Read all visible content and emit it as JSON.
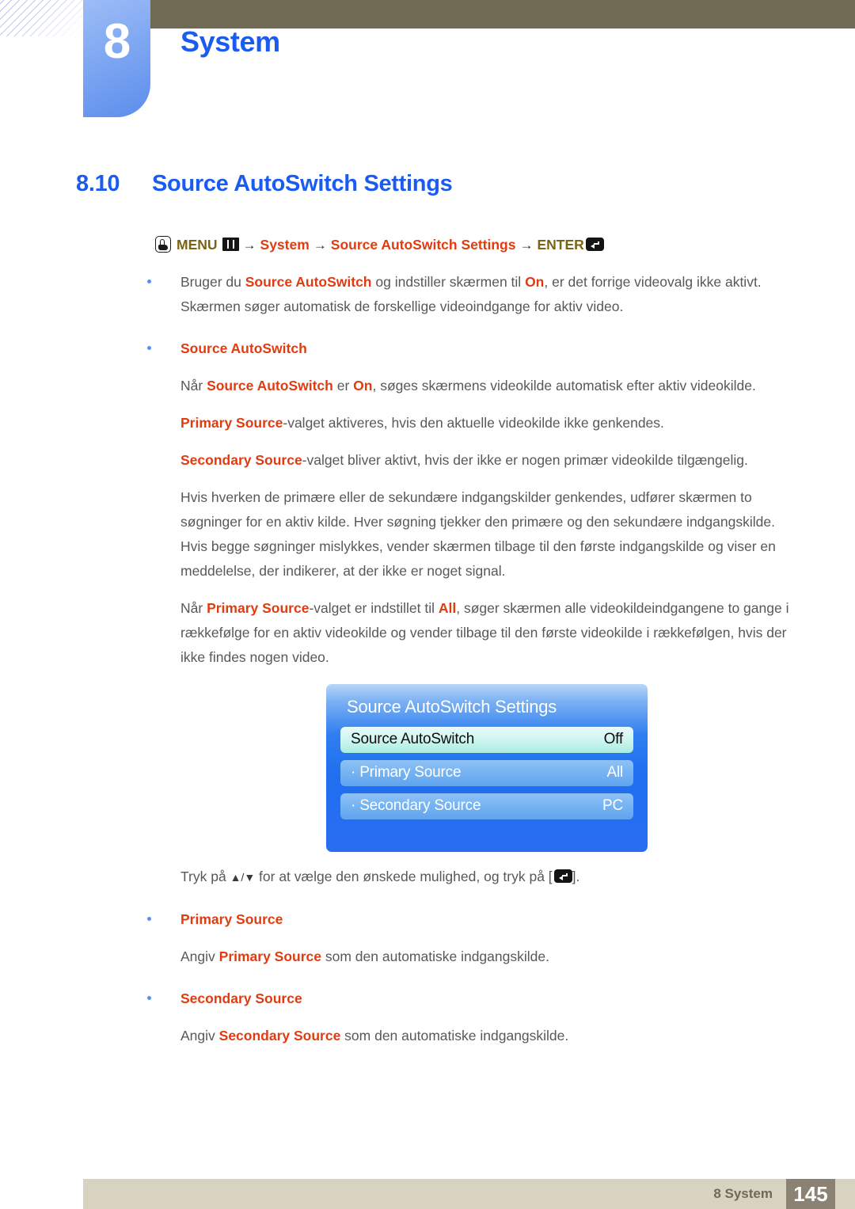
{
  "chapter": {
    "number": "8",
    "title": "System"
  },
  "section": {
    "number": "8.10",
    "title": "Source AutoSwitch Settings"
  },
  "menu_path": {
    "hand_icon": "hand-button-icon",
    "menu_label": "MENU",
    "grid_icon": "menu-grid-icon",
    "arrow1": "→",
    "item1": "System",
    "arrow2": "→",
    "item2": "Source AutoSwitch Settings",
    "arrow3": "→",
    "enter_label": "ENTER",
    "enter_icon": "enter-key-icon"
  },
  "body": {
    "bullet1_line1_pre": "Bruger du ",
    "bullet1_term1": "Source AutoSwitch",
    "bullet1_line1_mid": " og indstiller skærmen til ",
    "bullet1_term2": "On",
    "bullet1_line1_post": ", er det forrige videovalg ikke aktivt. Skærmen søger automatisk de forskellige videoindgange for aktiv video.",
    "bullet2_head": "Source AutoSwitch",
    "p1_pre": "Når ",
    "p1_term1": "Source AutoSwitch",
    "p1_mid": " er ",
    "p1_term2": "On",
    "p1_post": ", søges skærmens videokilde automatisk efter aktiv videokilde.",
    "p2_term": "Primary Source",
    "p2_post": "-valget aktiveres, hvis den aktuelle videokilde ikke genkendes.",
    "p3_term": "Secondary Source",
    "p3_post": "-valget bliver aktivt, hvis der ikke er nogen primær videokilde tilgængelig.",
    "p4": "Hvis hverken de primære eller de sekundære indgangskilder genkendes, udfører skærmen to søgninger for en aktiv kilde. Hver søgning tjekker den primære og den sekundære indgangskilde. Hvis begge søgninger mislykkes, vender skærmen tilbage til den første indgangskilde og viser en meddelelse, der indikerer, at der ikke er noget signal.",
    "p5_pre": "Når ",
    "p5_term1": "Primary Source",
    "p5_mid": "-valget er indstillet til ",
    "p5_term2": "All",
    "p5_post": ", søger skærmen alle videokildeindgangene to gange i rækkefølge for en aktiv videokilde og vender tilbage til den første videokilde i rækkefølgen, hvis der ikke findes nogen video.",
    "caption_pre": "Tryk på ",
    "caption_up": "▲",
    "caption_slash": "/",
    "caption_down": "▼",
    "caption_mid": " for at vælge den ønskede mulighed, og tryk på [",
    "caption_post": "].",
    "bullet3_head": "Primary Source",
    "p6_pre": "Angiv ",
    "p6_term": "Primary Source",
    "p6_post": " som den automatiske indgangskilde.",
    "bullet4_head": "Secondary Source",
    "p7_pre": "Angiv ",
    "p7_term": "Secondary Source",
    "p7_post": " som den automatiske indgangskilde."
  },
  "osd": {
    "title": "Source AutoSwitch Settings",
    "rows": [
      {
        "label": "Source AutoSwitch",
        "value": "Off",
        "selected": true
      },
      {
        "label": "· Primary Source",
        "value": "All",
        "selected": false
      },
      {
        "label": "· Secondary Source",
        "value": "PC",
        "selected": false
      }
    ]
  },
  "footer": {
    "label": "8 System",
    "page": "145"
  },
  "colors": {
    "heading_blue": "#1a5cf0",
    "term_red": "#e03c10",
    "menu_olive": "#7b6312",
    "olive_bar": "#6e6a53",
    "footer_beige": "#d8d3c0",
    "footer_page_block": "#8c8273",
    "osd_blue": "#1f6ff0",
    "osd_selected": "#d2f6f2"
  }
}
